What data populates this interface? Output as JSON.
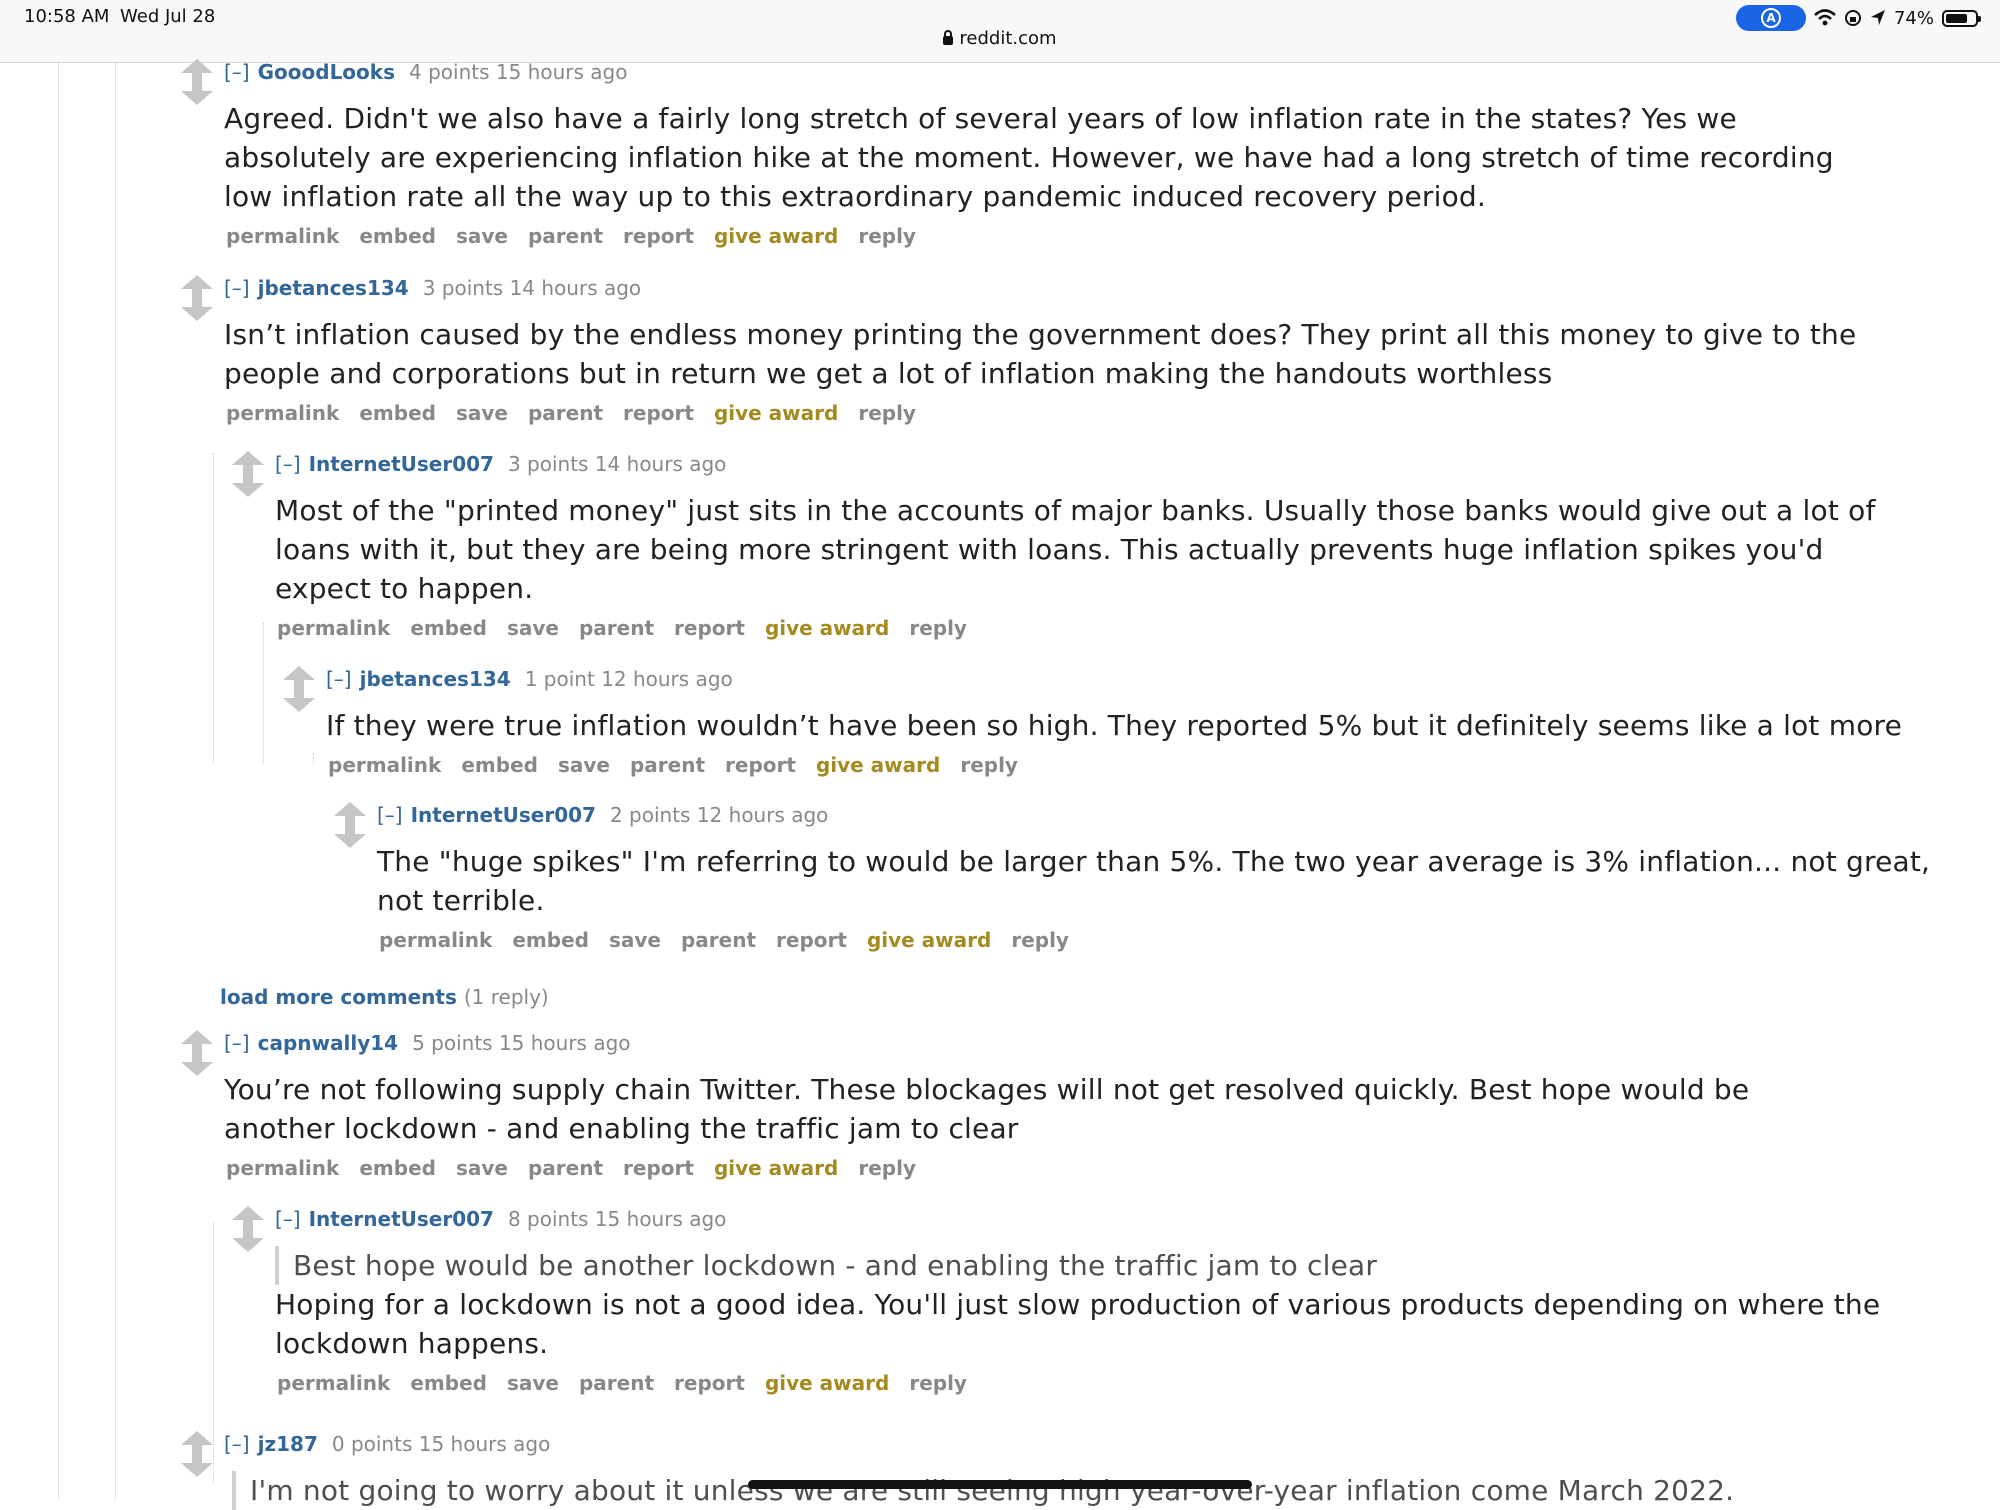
{
  "status_bar": {
    "time": "10:58 AM",
    "date": "Wed Jul 28",
    "url": "reddit.com",
    "battery": "74%",
    "indicator_letter": "A"
  },
  "labels": {
    "permalink": "permalink",
    "embed": "embed",
    "save": "save",
    "parent": "parent",
    "report": "report",
    "give_award": "give award",
    "reply": "reply",
    "expand": "[–]"
  },
  "comments": [
    {
      "author": "GooodLooks",
      "meta": "4 points 15 hours ago",
      "body": "Agreed. Didn't we also have a fairly long stretch of several years of low inflation rate in the states? Yes we absolutely are experiencing inflation hike at the moment. However, we have had a long stretch of time recording low inflation rate all the way up to this extraordinary pandemic induced recovery period."
    },
    {
      "author": "jbetances134",
      "meta": "3 points 14 hours ago",
      "body": "Isn’t inflation caused by the endless money printing the government does? They print all this money to give to the people and corporations but in return we get a lot of inflation making the handouts worthless"
    },
    {
      "author": "InternetUser007",
      "meta": "3 points 14 hours ago",
      "body": "Most of the \"printed money\" just sits in the accounts of major banks. Usually those banks would give out a lot of loans with it, but they are being more stringent with loans. This actually prevents huge inflation spikes you'd expect to happen."
    },
    {
      "author": "jbetances134",
      "meta": "1 point 12 hours ago",
      "body": "If they were true inflation wouldn’t have been so high. They reported 5% but it definitely seems like a lot more"
    },
    {
      "author": "InternetUser007",
      "meta": "2 points 12 hours ago",
      "body": "The \"huge spikes\" I'm referring to would be larger than 5%. The two year average is 3% inflation... not great, not terrible."
    },
    {
      "author": "capnwally14",
      "meta": "5 points 15 hours ago",
      "body": "You’re not following supply chain Twitter. These blockages will not get resolved quickly. Best hope would be another lockdown - and enabling the traffic jam to clear"
    },
    {
      "author": "InternetUser007",
      "meta": "8 points 15 hours ago",
      "quote": "Best hope would be another lockdown - and enabling the traffic jam to clear",
      "body": "Hoping for a lockdown is not a good idea. You'll just slow production of various products depending on where the lockdown happens."
    },
    {
      "author": "jz187",
      "meta": "0 points 15 hours ago",
      "quote": "I'm not going to worry about it unless we are still seeing high year-over-year inflation come March 2022."
    }
  ],
  "load_more": {
    "label": "load more comments",
    "count": "(1 reply)"
  }
}
